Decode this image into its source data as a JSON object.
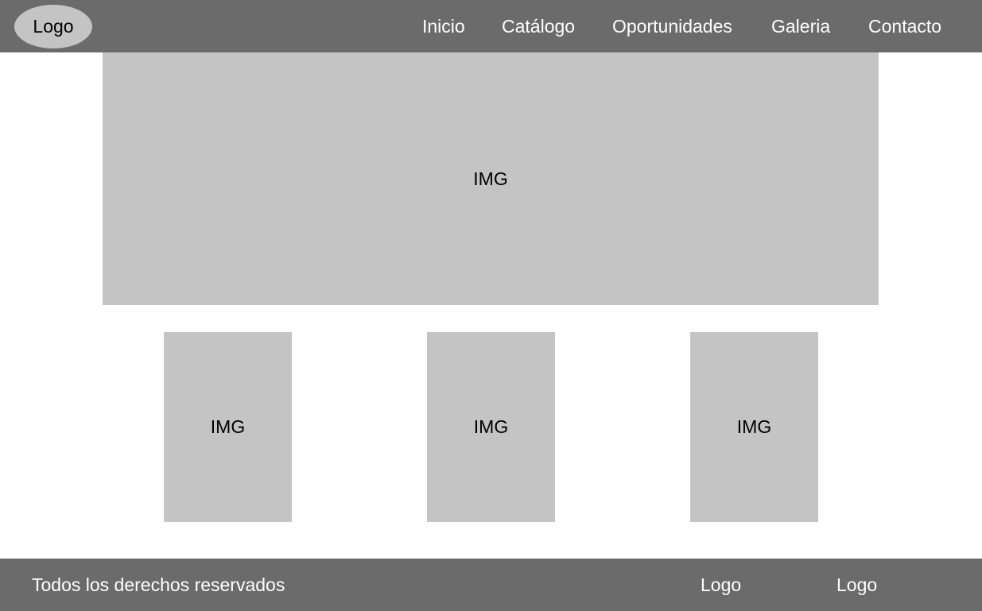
{
  "header": {
    "logo_label": "Logo",
    "nav": [
      "Inicio",
      "Catálogo",
      "Oportunidades",
      "Galeria",
      "Contacto"
    ]
  },
  "hero": {
    "label": "IMG"
  },
  "gallery": [
    "IMG",
    "IMG",
    "IMG"
  ],
  "footer": {
    "rights": "Todos los derechos reservados",
    "logos": [
      "Logo",
      "Logo"
    ]
  },
  "colors": {
    "bar": "#6b6b6b",
    "placeholder": "#c4c4c4",
    "bar_text": "#ffffff"
  }
}
